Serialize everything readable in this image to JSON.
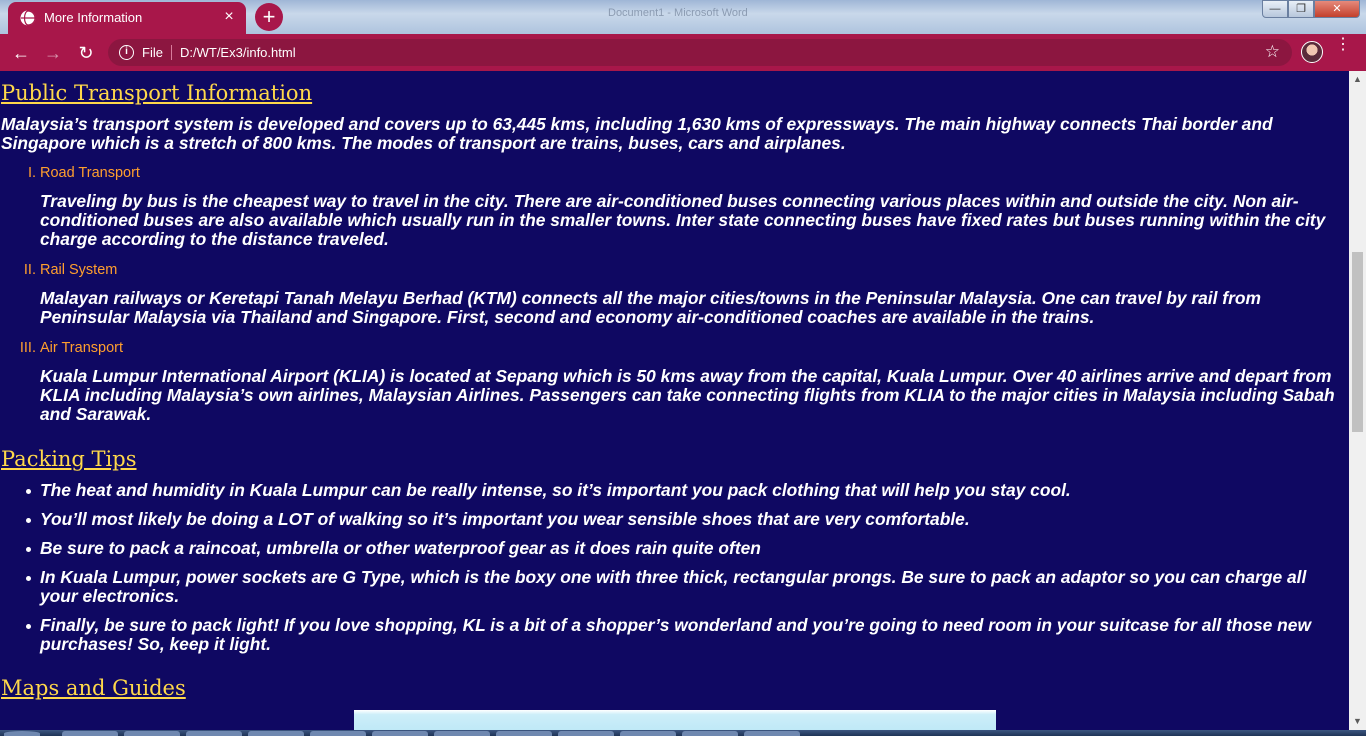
{
  "browser": {
    "tab_title": "More Information",
    "tab_close": "×",
    "new_tab": "+",
    "ghost_window_title": "Document1 - Microsoft Word",
    "win_min": "—",
    "win_max": "❐",
    "win_close": "✕",
    "nav_back": "←",
    "nav_forward": "→",
    "nav_reload": "↻",
    "info_icon": "i",
    "scheme": "File",
    "url": "D:/WT/Ex3/info.html",
    "star": "☆",
    "menu": "⋮"
  },
  "page": {
    "transport_heading": "Public Transport Information",
    "transport_intro": "Malaysia’s transport system is developed and covers up to 63,445 kms, including 1,630 kms of expressways. The main highway connects Thai border and Singapore which is a stretch of 800 kms. The modes of transport are trains, buses, cars and airplanes.",
    "transport_items": [
      {
        "num": "I.",
        "title": "Road Transport",
        "text": "Traveling by bus is the cheapest way to travel in the city. There are air-conditioned buses connecting various places within and outside the city. Non air-conditioned buses are also available which usually run in the smaller towns. Inter state connecting buses have fixed rates but buses running within the city charge according to the distance traveled."
      },
      {
        "num": "II.",
        "title": "Rail System",
        "text": "Malayan railways or Keretapi Tanah Melayu Berhad (KTM) connects all the major cities/towns in the Peninsular Malaysia. One can travel by rail from Peninsular Malaysia via Thailand and Singapore. First, second and economy air-conditioned coaches are available in the trains."
      },
      {
        "num": "III.",
        "title": "Air Transport",
        "text": "Kuala Lumpur International Airport (KLIA) is located at Sepang which is 50 kms away from the capital, Kuala Lumpur. Over 40 airlines arrive and depart from KLIA including Malaysia’s own airlines, Malaysian Airlines. Passengers can take connecting flights from KLIA to the major cities in Malaysia including Sabah and Sarawak."
      }
    ],
    "packing_heading": "Packing Tips",
    "packing_tips": [
      "The heat and humidity in Kuala Lumpur can be really intense, so it’s important you pack clothing that will help you stay cool.",
      "You’ll most likely be doing a LOT of walking so it’s important you wear sensible shoes that are very comfortable.",
      "Be sure to pack a raincoat, umbrella or other waterproof gear as it does rain quite often",
      "In Kuala Lumpur, power sockets are G Type, which is the boxy one with three thick, rectangular prongs. Be sure to pack an adaptor so you can charge all your electronics.",
      "Finally, be sure to pack light! If you love shopping, KL is a bit of a shopper’s wonderland and you’re going to need room in your suitcase for all those new purchases! So, keep it light."
    ],
    "maps_heading": "Maps and Guides"
  },
  "scrollbar": {
    "up": "▲",
    "down": "▼"
  },
  "colors": {
    "page_background": "#0f0862",
    "heading": "#ffd84a",
    "sublist_title": "#ff9f2e",
    "body_text": "#ffffff",
    "browser_accent": "#a8174a"
  }
}
